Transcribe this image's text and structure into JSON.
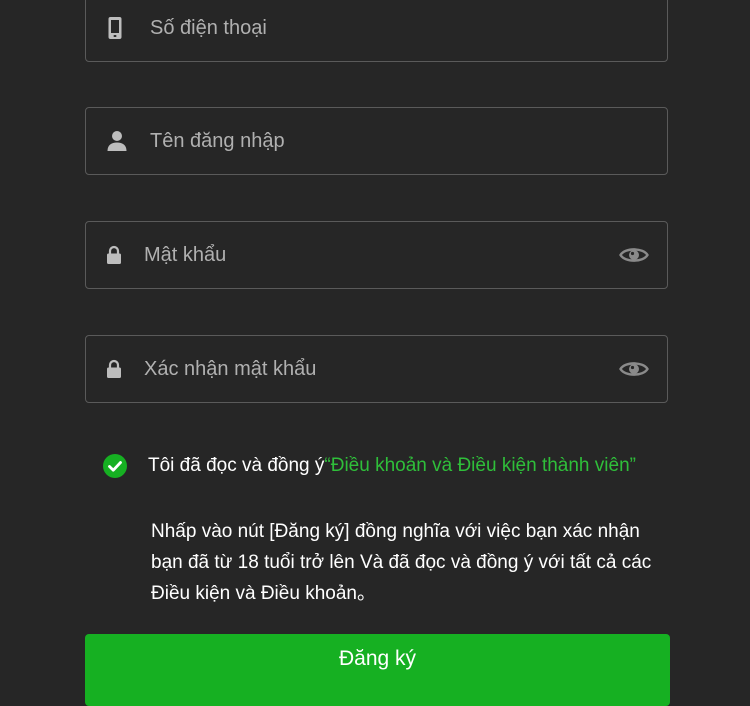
{
  "form": {
    "phone": {
      "value": "",
      "placeholder": "Số điện thoại",
      "icon": "phone-icon"
    },
    "username": {
      "value": "",
      "placeholder": "Tên đăng nhập",
      "icon": "user-icon"
    },
    "password": {
      "value": "",
      "placeholder": "Mật khẩu",
      "icon": "lock-icon",
      "toggle_icon": "eye-icon"
    },
    "confirm_password": {
      "value": "",
      "placeholder": "Xác nhận mật khẩu",
      "icon": "lock-icon",
      "toggle_icon": "eye-icon"
    }
  },
  "agreement": {
    "checked": true,
    "text": "Tôi đã đọc và đồng ý",
    "link_text": "“Điều khoản và Điều kiện thành viên”"
  },
  "notice": "Nhấp vào nút [Đăng ký] đồng nghĩa với việc bạn xác nhận bạn đã từ 18 tuổi trở lên Và đã đọc và đồng ý với tất cả các Điều kiện và Điều khoản。",
  "submit_label": "Đăng ký",
  "colors": {
    "background": "#262626",
    "accent": "#16b022",
    "link": "#2fbf3a",
    "border": "#5a5a5a"
  }
}
